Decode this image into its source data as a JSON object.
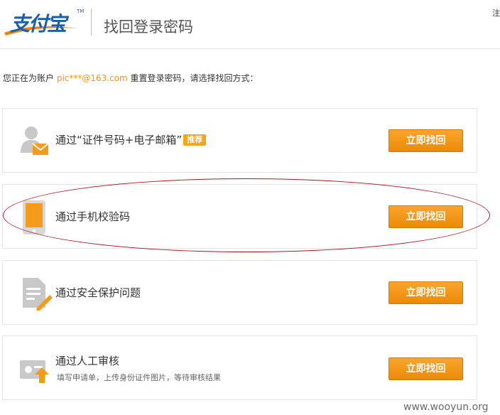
{
  "header": {
    "logo_text": "支付宝",
    "logo_tm": "TM",
    "title": "找回登录密码",
    "top_right_link": "注"
  },
  "intro": {
    "prefix": "您正在为账户 ",
    "account": "pic***@163.com",
    "suffix": " 重置登录密码，请选择找回方式："
  },
  "methods": [
    {
      "label": "通过“证件号码+电子邮箱”",
      "badge": "推荐",
      "button": "立即找回",
      "icon": "user-mail-icon"
    },
    {
      "label": "通过手机校验码",
      "button": "立即找回",
      "icon": "mobile-phone-icon"
    },
    {
      "label": "通过安全保护问题",
      "button": "立即找回",
      "icon": "document-edit-icon"
    },
    {
      "label": "通过人工审核",
      "sublabel": "填写申请单，上传身份证件图片，等待审核结果",
      "button": "立即找回",
      "icon": "id-card-upload-icon"
    }
  ],
  "colors": {
    "accent": "#f7931e",
    "button_orange": "#f39b1a",
    "brand_blue": "#1a5fad",
    "annotation_red": "#b5141d"
  },
  "watermark": "www.wooyun.org"
}
